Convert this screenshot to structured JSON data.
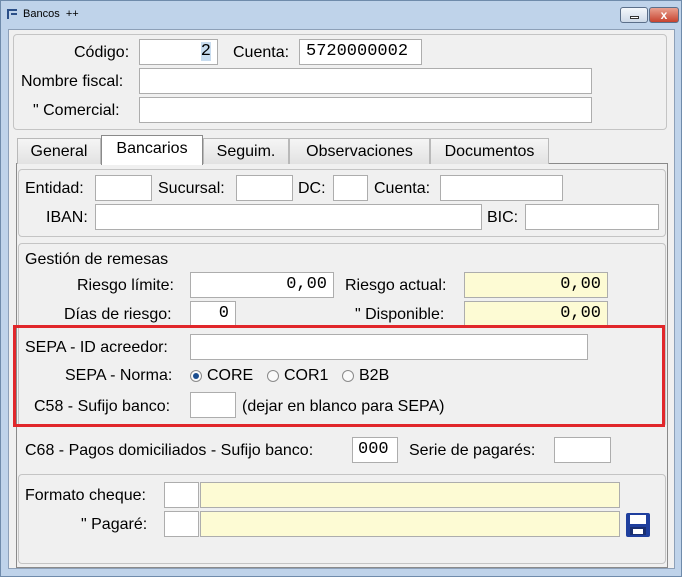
{
  "window": {
    "title": "Bancos",
    "title_suffix": "++",
    "close_glyph": "x"
  },
  "header": {
    "codigo_label": "Código:",
    "codigo_value": "2",
    "cuenta_label": "Cuenta:",
    "cuenta_value": "5720000002",
    "nombre_fiscal_label": "Nombre fiscal:",
    "nombre_fiscal_value": "",
    "comercial_label": "\"  Comercial:",
    "comercial_value": ""
  },
  "tabs": [
    {
      "label": "General"
    },
    {
      "label": "Bancarios"
    },
    {
      "label": "Seguim."
    },
    {
      "label": "Observaciones"
    },
    {
      "label": "Documentos"
    }
  ],
  "bank": {
    "entidad_label": "Entidad:",
    "sucursal_label": "Sucursal:",
    "dc_label": "DC:",
    "cuenta_label": "Cuenta:",
    "iban_label": "IBAN:",
    "bic_label": "BIC:",
    "entidad_value": "",
    "sucursal_value": "",
    "dc_value": "",
    "cuenta_value": "",
    "iban_value": "",
    "bic_value": ""
  },
  "remesas": {
    "title": "Gestión de remesas",
    "riesgo_limite_label": "Riesgo límite:",
    "riesgo_limite_value": "0,00",
    "riesgo_actual_label": "Riesgo actual:",
    "riesgo_actual_value": "0,00",
    "dias_riesgo_label": "Días de riesgo:",
    "dias_riesgo_value": "0",
    "disponible_label": "\"  Disponible:",
    "disponible_value": "0,00"
  },
  "sepa": {
    "id_acreedor_label": "SEPA - ID acreedor:",
    "id_acreedor_value": "",
    "norma_label": "SEPA - Norma:",
    "options": [
      {
        "label": "CORE",
        "selected": true
      },
      {
        "label": "COR1",
        "selected": false
      },
      {
        "label": "B2B",
        "selected": false
      }
    ],
    "c58_label": "C58 - Sufijo banco:",
    "c58_value": "",
    "c58_hint": "(dejar en blanco para SEPA)",
    "highlight_color": "#e1272b"
  },
  "c68": {
    "label": "C68 - Pagos domiciliados - Sufijo banco:",
    "value": "000",
    "serie_label": "Serie de pagarés:",
    "serie_value": ""
  },
  "formato": {
    "cheque_label": "Formato cheque:",
    "pagare_label": "\"  Pagaré:",
    "cheque_code": "",
    "cheque_value": "",
    "pagare_code": "",
    "pagare_value": ""
  },
  "icons": {
    "save": "save-icon",
    "app": "app-icon"
  }
}
